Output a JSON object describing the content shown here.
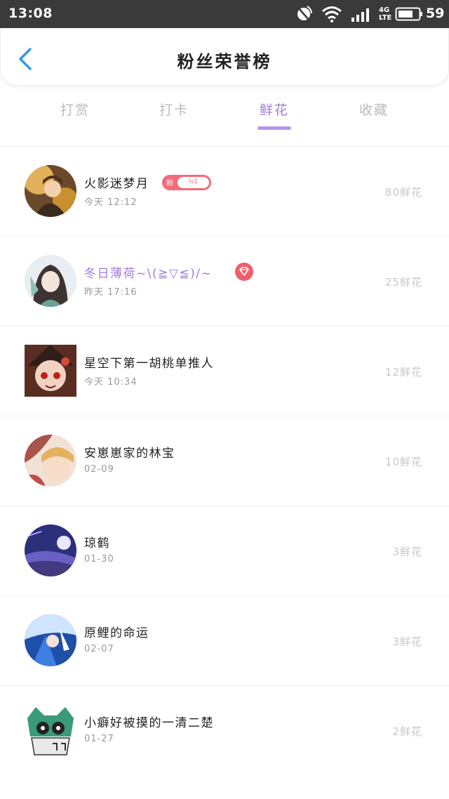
{
  "status_bar": {
    "time": "13:08",
    "network": "4G\nLTE",
    "battery": "59"
  },
  "header": {
    "title": "粉丝荣誉榜"
  },
  "tabs": [
    {
      "label": "打赏",
      "active": false
    },
    {
      "label": "打卡",
      "active": false
    },
    {
      "label": "鲜花",
      "active": true
    },
    {
      "label": "收藏",
      "active": false
    }
  ],
  "list": [
    {
      "name": "火影迷梦月",
      "time": "今天 12:12",
      "value": "80鲜花",
      "badge": {
        "fan": "粉",
        "level": "lv1"
      }
    },
    {
      "name": "冬日薄荷~\\(≧▽≦)/~",
      "time": "昨天 17:16",
      "value": "25鲜花",
      "name_color": "#a07be0"
    },
    {
      "name": "星空下第一胡桃单推人",
      "time": "今天 10:34",
      "value": "12鲜花"
    },
    {
      "name": "安崽崽家的林宝",
      "time": "02-09",
      "value": "10鲜花"
    },
    {
      "name": "琼鹤",
      "time": "01-30",
      "value": "3鲜花"
    },
    {
      "name": "原鲤的命运",
      "time": "02-07",
      "value": "3鲜花"
    },
    {
      "name": "小癖好被摸的一清二楚",
      "time": "01-27",
      "value": "2鲜花"
    }
  ],
  "colors": {
    "accent": "#a07be0",
    "badge": "#f46b79",
    "back_arrow": "#2f9be6"
  }
}
